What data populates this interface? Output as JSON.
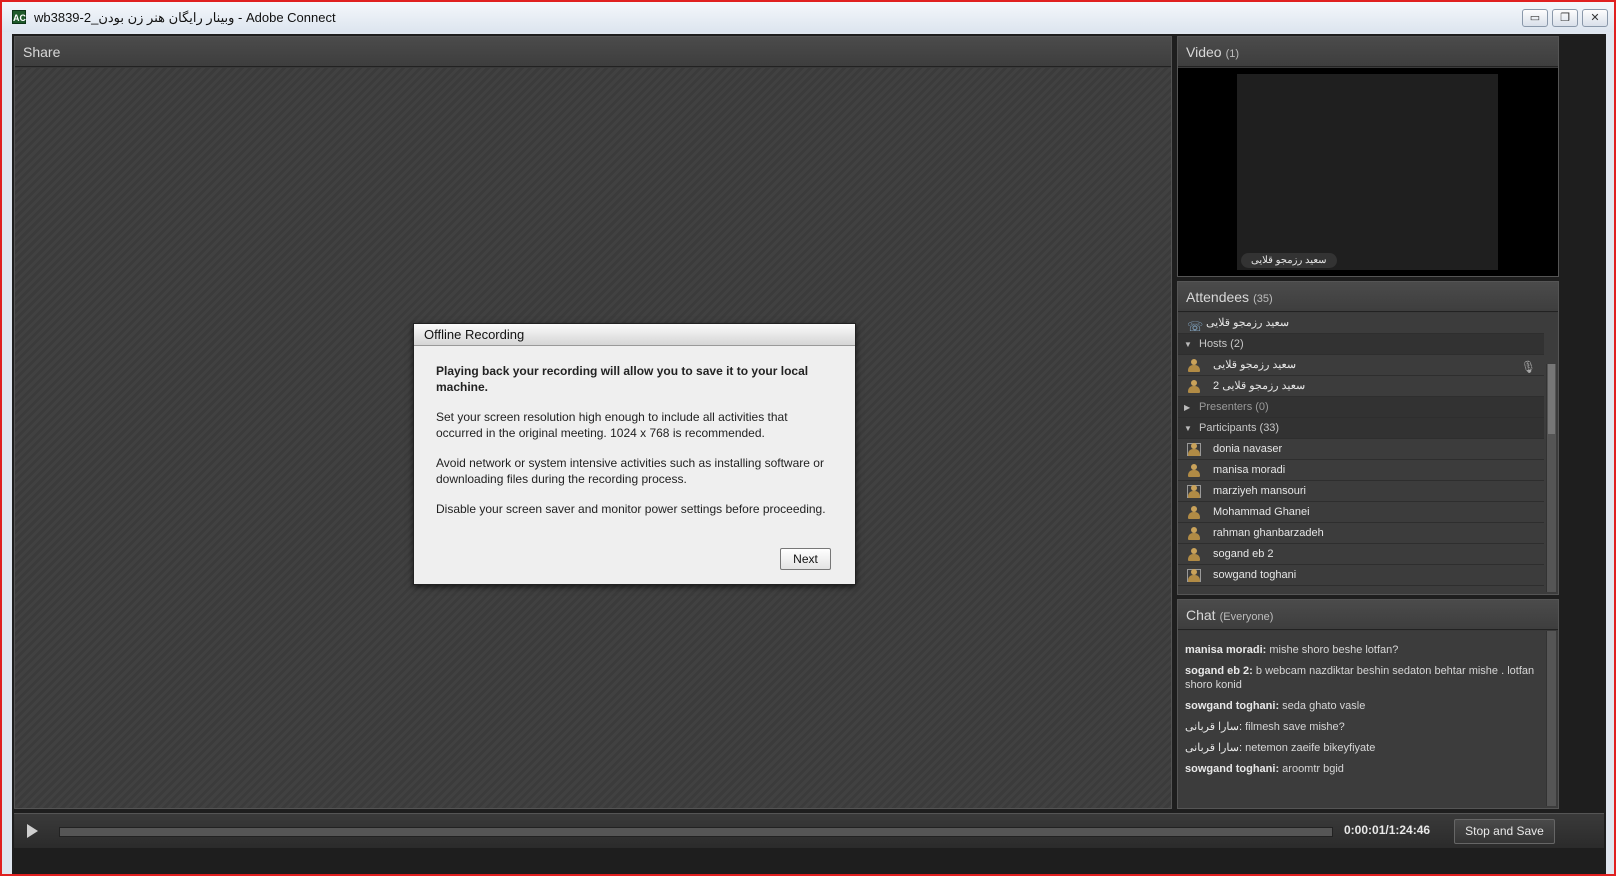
{
  "window": {
    "title": "wb3839-2_وبينار رايگان هنر زن بودن - Adobe Connect",
    "app_icon": "AC",
    "buttons": {
      "minimize": "▭",
      "restore": "❐",
      "close": "✕"
    }
  },
  "share": {
    "title": "Share"
  },
  "dialog": {
    "title": "Offline Recording",
    "paragraphs": [
      "Playing back your recording will allow you to save it to your local machine.",
      "Set your screen resolution high enough to include all activities that occurred in the original meeting. 1024 x 768 is recommended.",
      "Avoid network or system intensive activities such as installing software or downloading files during the recording process.",
      "Disable your screen saver and monitor power settings before proceeding."
    ],
    "next_label": "Next"
  },
  "video": {
    "title": "Video",
    "count": "(1)",
    "name_tag": "سعید رزمجو قلایی"
  },
  "attendees": {
    "title": "Attendees",
    "count": "(35)",
    "phone_user": "سعید رزمجو قلایی",
    "hosts_label": "Hosts (2)",
    "hosts": [
      "سعید رزمجو قلایی",
      "2 سعید رزمجو قلایی"
    ],
    "presenters_label": "Presenters (0)",
    "participants_label": "Participants (33)",
    "participants": [
      "donia navaser",
      "manisa moradi",
      "marziyeh mansouri",
      "Mohammad Ghanei",
      "rahman ghanbarzadeh",
      "sogand eb 2",
      "sowgand toghani"
    ]
  },
  "chat": {
    "title": "Chat",
    "audience": "(Everyone)",
    "messages": [
      {
        "who": "manisa moradi:",
        "text": " mishe shoro beshe lotfan?"
      },
      {
        "who": "sogand eb 2:",
        "text": " b webcam nazdiktar beshin sedaton behtar mishe . lotfan shoro konid"
      },
      {
        "who": "sowgand toghani:",
        "text": " seda ghato vasle"
      },
      {
        "who": "سارا قربانی:",
        "text": " filmesh save mishe?"
      },
      {
        "who": "سارا قربانی:",
        "text": " netemon zaeife bikeyfiyate"
      },
      {
        "who": "sowgand toghani:",
        "text": " aroomtr bgid"
      }
    ]
  },
  "playback": {
    "time": "0:00:01/1:24:46",
    "stop_label": "Stop and Save",
    "progress": 0.0
  }
}
